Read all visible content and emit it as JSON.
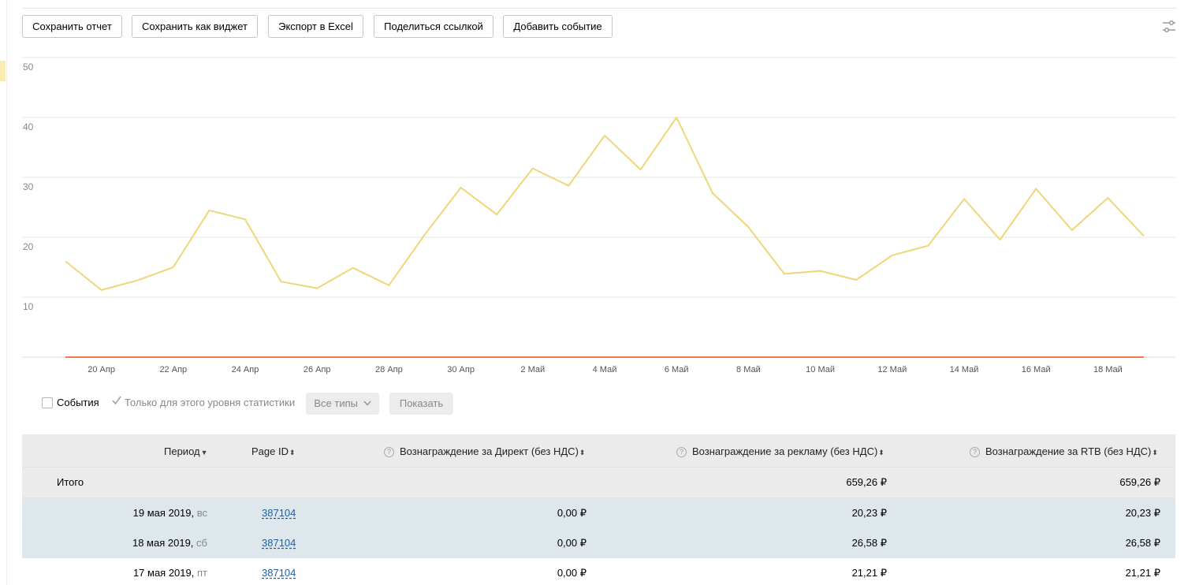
{
  "toolbar": {
    "save_report": "Сохранить отчет",
    "save_widget": "Сохранить как виджет",
    "export_excel": "Экспорт в Excel",
    "share_link": "Поделиться ссылкой",
    "add_event": "Добавить событие"
  },
  "filters": {
    "events_label": "События",
    "level_only_label": "Только для этого уровня статистики",
    "all_types_label": "Все типы",
    "show_label": "Показать"
  },
  "table": {
    "headers": {
      "period": "Период",
      "page_id": "Page ID",
      "direct": "Вознаграждение за Директ (без НДС)",
      "ads": "Вознаграждение за рекламу (без НДС)",
      "rtb": "Вознаграждение за RTB (без НДС)"
    },
    "total": {
      "label": "Итого",
      "direct": "",
      "ads": "659,26 ₽",
      "rtb": "659,26 ₽"
    },
    "rows": [
      {
        "date": "19 мая 2019,",
        "weekday": "вс",
        "page_id": "387104",
        "direct": "0,00 ₽",
        "ads": "20,23 ₽",
        "rtb": "20,23 ₽"
      },
      {
        "date": "18 мая 2019,",
        "weekday": "сб",
        "page_id": "387104",
        "direct": "0,00 ₽",
        "ads": "26,58 ₽",
        "rtb": "26,58 ₽"
      },
      {
        "date": "17 мая 2019,",
        "weekday": "пт",
        "page_id": "387104",
        "direct": "0,00 ₽",
        "ads": "21,21 ₽",
        "rtb": "21,21 ₽"
      }
    ]
  },
  "chart_data": {
    "type": "line",
    "ylim": [
      0,
      50
    ],
    "yticks": [
      10,
      20,
      30,
      40,
      50
    ],
    "xticks": [
      "20 Апр",
      "22 Апр",
      "24 Апр",
      "26 Апр",
      "28 Апр",
      "30 Апр",
      "2 Май",
      "4 Май",
      "6 Май",
      "8 Май",
      "10 Май",
      "12 Май",
      "14 Май",
      "16 Май",
      "18 Май"
    ],
    "grid": true,
    "x": [
      "19 Апр",
      "20 Апр",
      "21 Апр",
      "22 Апр",
      "23 Апр",
      "24 Апр",
      "25 Апр",
      "26 Апр",
      "27 Апр",
      "28 Апр",
      "29 Апр",
      "30 Апр",
      "1 Май",
      "2 Май",
      "3 Май",
      "4 Май",
      "5 Май",
      "6 Май",
      "7 Май",
      "8 Май",
      "9 Май",
      "10 Май",
      "11 Май",
      "12 Май",
      "13 Май",
      "14 Май",
      "15 Май",
      "16 Май",
      "17 Май",
      "18 Май",
      "19 Май"
    ],
    "series": [
      {
        "color": "#eed679",
        "values": [
          16,
          11.2,
          12.8,
          15,
          24.5,
          23,
          12.6,
          11.5,
          14.9,
          12,
          20.5,
          28.3,
          23.8,
          31.5,
          28.6,
          37,
          31.3,
          40,
          27.4,
          21.7,
          13.9,
          14.4,
          12.9,
          17,
          18.6,
          26.4,
          19.6,
          28.1,
          21.2,
          26.58,
          20.23
        ]
      },
      {
        "color": "#f07a48",
        "values": [
          0,
          0,
          0,
          0,
          0,
          0,
          0,
          0,
          0,
          0,
          0,
          0,
          0,
          0,
          0,
          0,
          0,
          0,
          0,
          0,
          0,
          0,
          0,
          0,
          0,
          0,
          0,
          0,
          0,
          0,
          0
        ]
      }
    ]
  }
}
